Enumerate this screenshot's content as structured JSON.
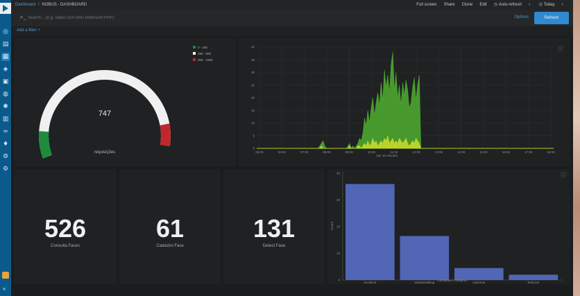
{
  "header": {
    "breadcrumb_root": "Dashboard",
    "breadcrumb_separator": "/",
    "breadcrumb_title": "NOBUS - DASHBOARD",
    "links": [
      {
        "icon": "",
        "label": "Full screen"
      },
      {
        "icon": "",
        "label": "Share"
      },
      {
        "icon": "",
        "label": "Clone"
      },
      {
        "icon": "",
        "label": "Edit"
      },
      {
        "icon": "clock-icon",
        "label": "Auto-refresh"
      },
      {
        "icon": "chevron-left-icon",
        "label": ""
      },
      {
        "icon": "clock-icon",
        "label": "Today"
      },
      {
        "icon": "chevron-right-icon",
        "label": ""
      }
    ]
  },
  "search": {
    "placeholder": "Search... (e.g. status:200 AND extension:PHP)",
    "options_label": "Options",
    "refresh_label": "Refresh"
  },
  "filter": {
    "add_label": "Add a filter +"
  },
  "gauge": {
    "value": "747",
    "label": "requisições",
    "legend": [
      {
        "label": "0 - 250",
        "color": "#1f8c3b"
      },
      {
        "label": "250 - 500",
        "color": "#f2f2f2"
      },
      {
        "label": "500 - 1000",
        "color": "#c0272d"
      }
    ],
    "fill_fraction": 0.95,
    "colors": {
      "track": "#f0f0f0",
      "green": "#1f8c3b",
      "red": "#c0272d"
    }
  },
  "metrics": [
    {
      "value": "526",
      "label": "Consulta Faces"
    },
    {
      "value": "61",
      "label": "Cadastro Face"
    },
    {
      "value": "131",
      "label": "Detect Face"
    }
  ],
  "chart_data": [
    {
      "type": "area",
      "ylim": [
        0,
        40
      ],
      "yticks": [
        "0",
        "5",
        "10",
        "15",
        "20",
        "25",
        "30",
        "35",
        "40"
      ],
      "xticks": [
        "05:00",
        "06:00",
        "07:00",
        "08:00",
        "09:00",
        "10:00",
        "11:00",
        "12:00",
        "13:00",
        "14:00",
        "15:00",
        "16:00",
        "17:00",
        "18:00"
      ],
      "xlabel": "per 15 minutes",
      "series": [
        {
          "color": "#4fae2f",
          "values": [
            0,
            0,
            0,
            0,
            0,
            0,
            0,
            0,
            0,
            0,
            0,
            0,
            0,
            0,
            0,
            0,
            0,
            0,
            0,
            0,
            0,
            0,
            0,
            0,
            0,
            0,
            0,
            0,
            0,
            0,
            0,
            0,
            0,
            0,
            0,
            0,
            0,
            0,
            1,
            2,
            3,
            1,
            0,
            0,
            0,
            0,
            0,
            0,
            0,
            0,
            0,
            0,
            0,
            0,
            0,
            1,
            2,
            0,
            1,
            0,
            1,
            2,
            4,
            3,
            6,
            12,
            9,
            15,
            10,
            16,
            20,
            13,
            18,
            22,
            17,
            26,
            19,
            31,
            24,
            29,
            22,
            33,
            38,
            23,
            30,
            20,
            25,
            17,
            26,
            21,
            27,
            23,
            16,
            18,
            24,
            28,
            19,
            25,
            29,
            0,
            0,
            0,
            0,
            0,
            0,
            0,
            0,
            0,
            0,
            0,
            0,
            0,
            0,
            0,
            0,
            0,
            0,
            0,
            0,
            0,
            0,
            0,
            0,
            0,
            0,
            0,
            0,
            0,
            0,
            0,
            0,
            0,
            0,
            0,
            0,
            0,
            0,
            0,
            0,
            0,
            0,
            0,
            0,
            0,
            0,
            0,
            0,
            0,
            0,
            0,
            0,
            0,
            0,
            0,
            0,
            0,
            0,
            0,
            0,
            0,
            0,
            0,
            0,
            0,
            0,
            0,
            0,
            0,
            0,
            0,
            0,
            0,
            0,
            0,
            0,
            0,
            0,
            0,
            0,
            0
          ]
        },
        {
          "color": "#c7d92a",
          "values": [
            0,
            0,
            0,
            0,
            0,
            0,
            0,
            0,
            0,
            0,
            0,
            0,
            0,
            0,
            0,
            0,
            0,
            0,
            0,
            0,
            0,
            0,
            0,
            0,
            0,
            0,
            0,
            0,
            0,
            0,
            0,
            0,
            0,
            0,
            0,
            0,
            0,
            0,
            0,
            1,
            0,
            0,
            0,
            0,
            0,
            0,
            0,
            0,
            0,
            0,
            0,
            0,
            0,
            0,
            0,
            0,
            1,
            0,
            0,
            0,
            0,
            1,
            1,
            0,
            1,
            2,
            1,
            3,
            1,
            2,
            4,
            2,
            3,
            1,
            2,
            3,
            2,
            4,
            3,
            5,
            2,
            3,
            4,
            2,
            3,
            2,
            4,
            3,
            2,
            3,
            4,
            2,
            1,
            2,
            3,
            2,
            4,
            3,
            2,
            0,
            0,
            0,
            0,
            0,
            0,
            0,
            0,
            0,
            0,
            0,
            0,
            0,
            0,
            0,
            0,
            0,
            0,
            0,
            0,
            0,
            0,
            0,
            0,
            0,
            0,
            0,
            0,
            0,
            0,
            0,
            0,
            0,
            0,
            0,
            0,
            0,
            0,
            0,
            0,
            0,
            0,
            0,
            0,
            0,
            0,
            0,
            0,
            0,
            0,
            0,
            0,
            0,
            0,
            0,
            0,
            0,
            0,
            0,
            0,
            0,
            0,
            0,
            0,
            0,
            0,
            0,
            0,
            0,
            0,
            0,
            0,
            0,
            0,
            0,
            0,
            0,
            0,
            0,
            0,
            0
          ]
        }
      ]
    },
    {
      "type": "bar",
      "categories": [
        "localhost",
        "webkatrakking",
        "customer",
        "TestUser"
      ],
      "values": [
        36,
        16.5,
        4.5,
        2
      ],
      "ylim": [
        0,
        40
      ],
      "yticks": [
        "0",
        "10",
        "20",
        "30",
        "40"
      ],
      "ylabel": "Count",
      "xlabel": "Consultas X Usuários",
      "color": "#5166b5"
    }
  ]
}
